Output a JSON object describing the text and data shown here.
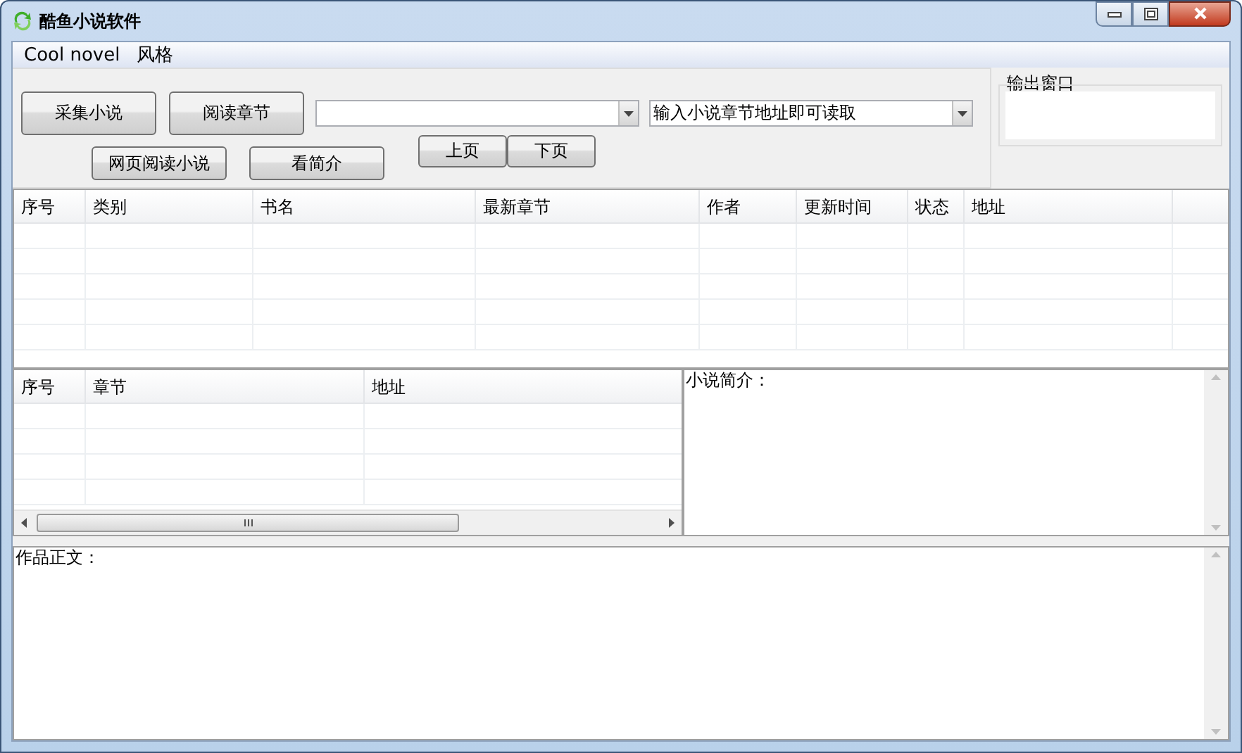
{
  "window": {
    "title": "酷鱼小说软件"
  },
  "menu": [
    "Cool novel",
    "风格"
  ],
  "buttons": {
    "collect": "采集小说",
    "read_chapter": "阅读章节",
    "web_read": "网页阅读小说",
    "summary": "看简介",
    "prev": "上页",
    "next": "下页"
  },
  "address_combo": {
    "value": "输入小说章节地址即可读取"
  },
  "output_window": {
    "title": "输出窗口"
  },
  "novel_table": {
    "columns": [
      "序号",
      "类别",
      "书名",
      "最新章节",
      "作者",
      "更新时间",
      "状态",
      "地址"
    ]
  },
  "chapter_table": {
    "columns": [
      "序号",
      "章节",
      "地址"
    ]
  },
  "summary_box": {
    "label": "小说简介："
  },
  "content_box": {
    "label": "作品正文："
  }
}
